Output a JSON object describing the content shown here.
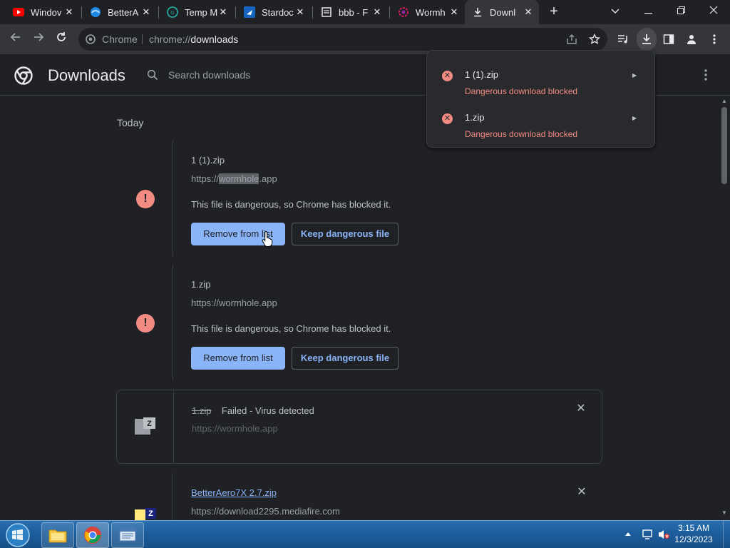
{
  "tabs": [
    {
      "title": "Windov",
      "icon": "youtube-icon"
    },
    {
      "title": "BetterA",
      "icon": "edge-like-icon"
    },
    {
      "title": "Temp M",
      "icon": "temp-mail-icon"
    },
    {
      "title": "Stardoc",
      "icon": "stardock-icon"
    },
    {
      "title": "bbb - F",
      "icon": "page-icon"
    },
    {
      "title": "Wormh",
      "icon": "wormhole-icon"
    },
    {
      "title": "Downl",
      "icon": "download-icon",
      "active": true
    }
  ],
  "toolbar": {
    "site_chip": "Chrome",
    "url_scheme": "chrome://",
    "url_host": "downloads"
  },
  "page": {
    "title": "Downloads",
    "search_placeholder": "Search downloads",
    "date_label": "Today"
  },
  "downloads": [
    {
      "name": "1 (1).zip",
      "url_prefix": "https://",
      "url_highlight": "wormhole",
      "url_suffix": ".app",
      "warning": "This file is dangerous, so Chrome has blocked it.",
      "primary_button": "Remove from list",
      "secondary_button": "Keep dangerous file"
    },
    {
      "name": "1.zip",
      "url": "https://wormhole.app",
      "warning": "This file is dangerous, so Chrome has blocked it.",
      "primary_button": "Remove from list",
      "secondary_button": "Keep dangerous file"
    },
    {
      "name": "1.zip",
      "status": "Failed - Virus detected",
      "url": "https://wormhole.app"
    },
    {
      "name": "BetterAero7X 2.7.zip",
      "url": "https://download2295.mediafire.com"
    }
  ],
  "bubble": {
    "items": [
      {
        "name": "1 (1).zip",
        "status": "Dangerous download blocked"
      },
      {
        "name": "1.zip",
        "status": "Dangerous download blocked"
      }
    ]
  },
  "taskbar": {
    "time": "3:15 AM",
    "date": "12/3/2023"
  },
  "colors": {
    "danger": "#f28b82",
    "accent": "#8ab4f8",
    "background": "#202124"
  }
}
